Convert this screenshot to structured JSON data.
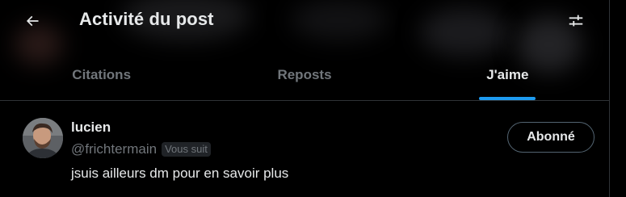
{
  "header": {
    "title": "Activité du post",
    "back_icon": "arrow-left-icon",
    "filter_icon": "sliders-icon"
  },
  "tabs": [
    {
      "label": "Citations",
      "active": false
    },
    {
      "label": "Reposts",
      "active": false
    },
    {
      "label": "J'aime",
      "active": true
    }
  ],
  "users": [
    {
      "name": "lucien",
      "handle": "@frichtermain",
      "follows_you_badge": "Vous suit",
      "bio": "jsuis ailleurs dm pour en savoir plus",
      "follow_button_label": "Abonné"
    }
  ],
  "colors": {
    "accent": "#1d9bf0",
    "background": "#000000",
    "primary_text": "#e7e9ea",
    "secondary_text": "#71767b",
    "border": "#2f3336"
  }
}
